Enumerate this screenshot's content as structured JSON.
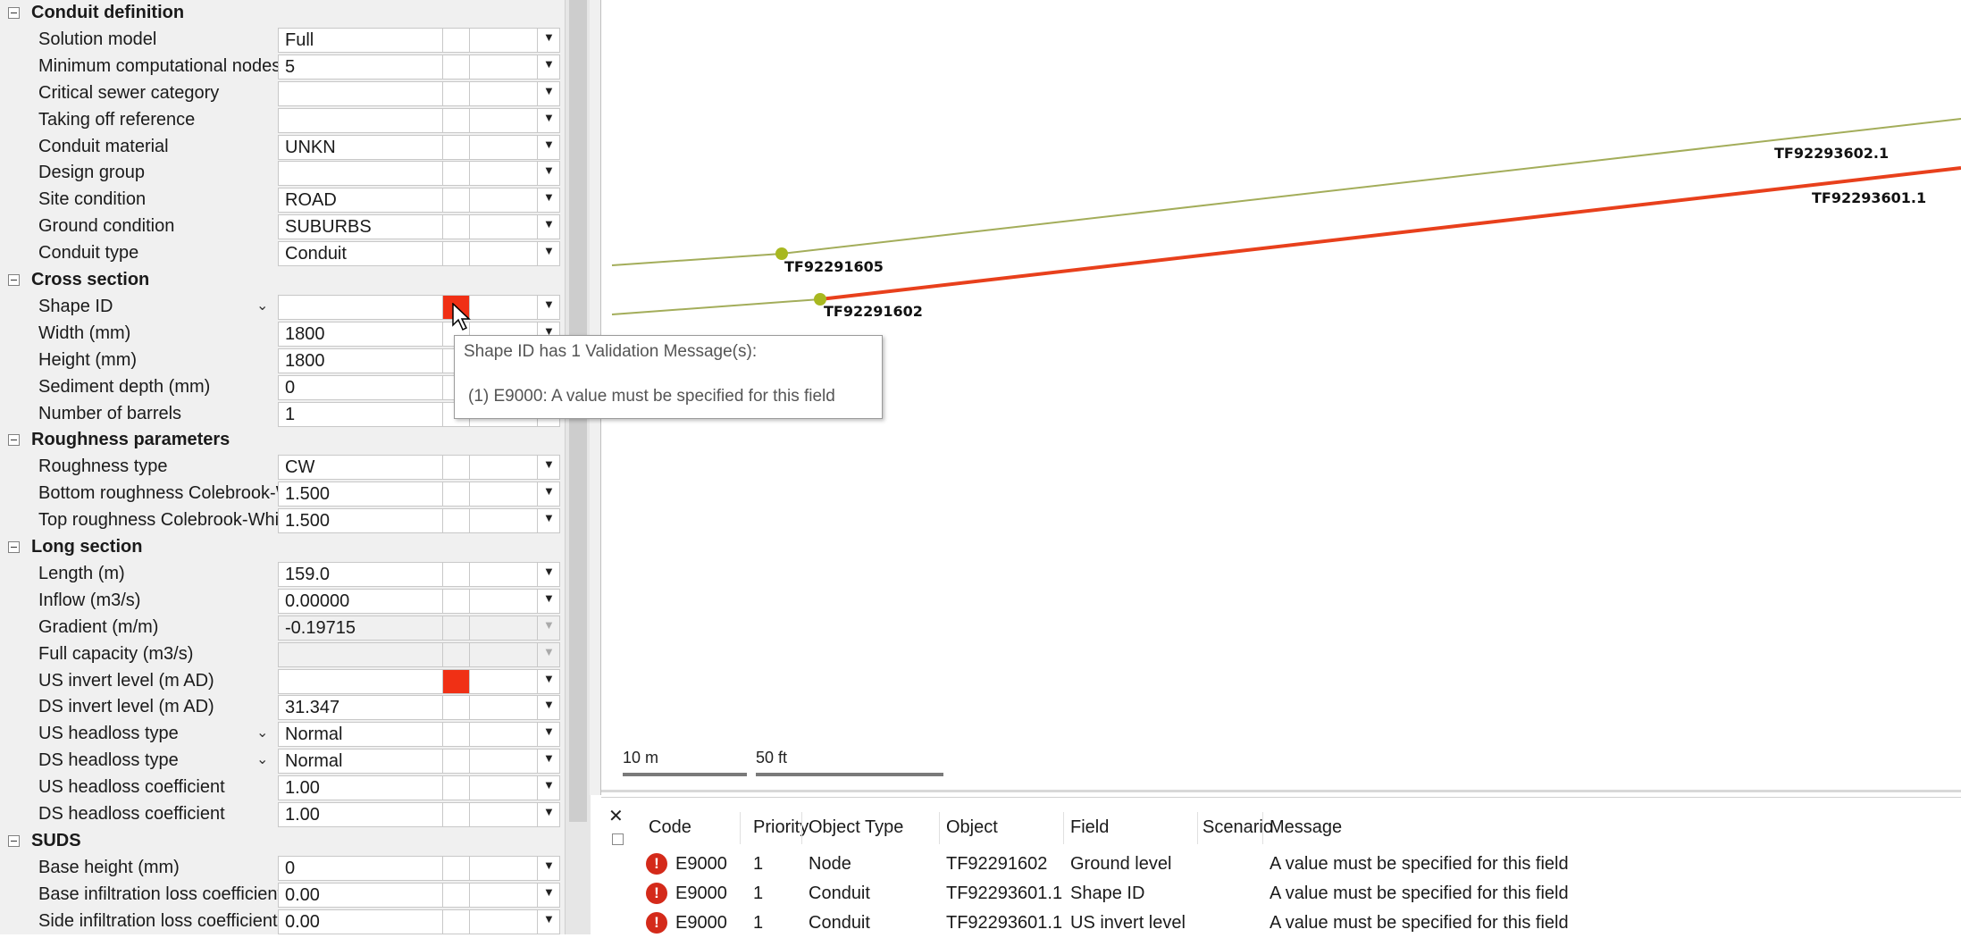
{
  "grid": {
    "sections": [
      {
        "title": "Conduit definition",
        "rows": [
          {
            "label": "Solution model",
            "value": "Full"
          },
          {
            "label": "Minimum computational nodes",
            "value": "5"
          },
          {
            "label": "Critical sewer category",
            "value": ""
          },
          {
            "label": "Taking off reference",
            "value": ""
          },
          {
            "label": "Conduit material",
            "value": "UNKN"
          },
          {
            "label": "Design group",
            "value": ""
          },
          {
            "label": "Site condition",
            "value": "ROAD"
          },
          {
            "label": "Ground condition",
            "value": "SUBURBS"
          },
          {
            "label": "Conduit type",
            "value": "Conduit"
          }
        ]
      },
      {
        "title": "Cross section",
        "rows": [
          {
            "label": "Shape ID",
            "value": "",
            "chevron": true,
            "flag": true
          },
          {
            "label": "Width (mm)",
            "value": "1800"
          },
          {
            "label": "Height (mm)",
            "value": "1800"
          },
          {
            "label": "Sediment depth (mm)",
            "value": "0"
          },
          {
            "label": "Number of barrels",
            "value": "1"
          }
        ]
      },
      {
        "title": "Roughness parameters",
        "rows": [
          {
            "label": "Roughness type",
            "value": "CW"
          },
          {
            "label": "Bottom roughness Colebrook-White",
            "value": "1.500"
          },
          {
            "label": "Top roughness Colebrook-White",
            "value": "1.500"
          }
        ]
      },
      {
        "title": "Long section",
        "rows": [
          {
            "label": "Length (m)",
            "value": "159.0"
          },
          {
            "label": "Inflow (m3/s)",
            "value": "0.00000"
          },
          {
            "label": "Gradient (m/m)",
            "value": "-0.19715",
            "disabled": true
          },
          {
            "label": "Full capacity (m3/s)",
            "value": "",
            "disabled": true
          },
          {
            "label": "US invert level (m AD)",
            "value": "",
            "flag": true
          },
          {
            "label": "DS invert level (m AD)",
            "value": "31.347"
          },
          {
            "label": "US headloss type",
            "value": "Normal",
            "chevron": true
          },
          {
            "label": "DS headloss type",
            "value": "Normal",
            "chevron": true
          },
          {
            "label": "US headloss coefficient",
            "value": "1.00"
          },
          {
            "label": "DS headloss coefficient",
            "value": "1.00"
          }
        ]
      },
      {
        "title": "SUDS",
        "rows": [
          {
            "label": "Base height (mm)",
            "value": "0"
          },
          {
            "label": "Base infiltration loss coefficient",
            "value": "0.00"
          },
          {
            "label": "Side infiltration loss coefficient",
            "value": "0.00"
          }
        ]
      }
    ]
  },
  "map": {
    "node_labels": [
      "TF92291605",
      "TF92291602",
      "TF92293602.1",
      "TF92293601.1"
    ],
    "scale": {
      "metric": "10 m",
      "imperial": "50 ft"
    },
    "colors": {
      "link": "#a3ad5a",
      "selected_link": "#e8401c",
      "node": "#a8b820"
    }
  },
  "tooltip": {
    "title": "Shape ID has 1 Validation Message(s):",
    "message": "(1) E9000: A value must be specified for this field"
  },
  "messages": {
    "headers": [
      "Code",
      "Priority",
      "Object Type",
      "Object",
      "Field",
      "Scenario",
      "Message"
    ],
    "rows": [
      [
        "E9000",
        "1",
        "Node",
        "TF92291602",
        "Ground level",
        "",
        "A value must be specified for this field"
      ],
      [
        "E9000",
        "1",
        "Conduit",
        "TF92293601.1",
        "Shape ID",
        "",
        "A value must be specified for this field"
      ],
      [
        "E9000",
        "1",
        "Conduit",
        "TF92293601.1",
        "US invert level",
        "",
        "A value must be specified for this field"
      ]
    ]
  }
}
